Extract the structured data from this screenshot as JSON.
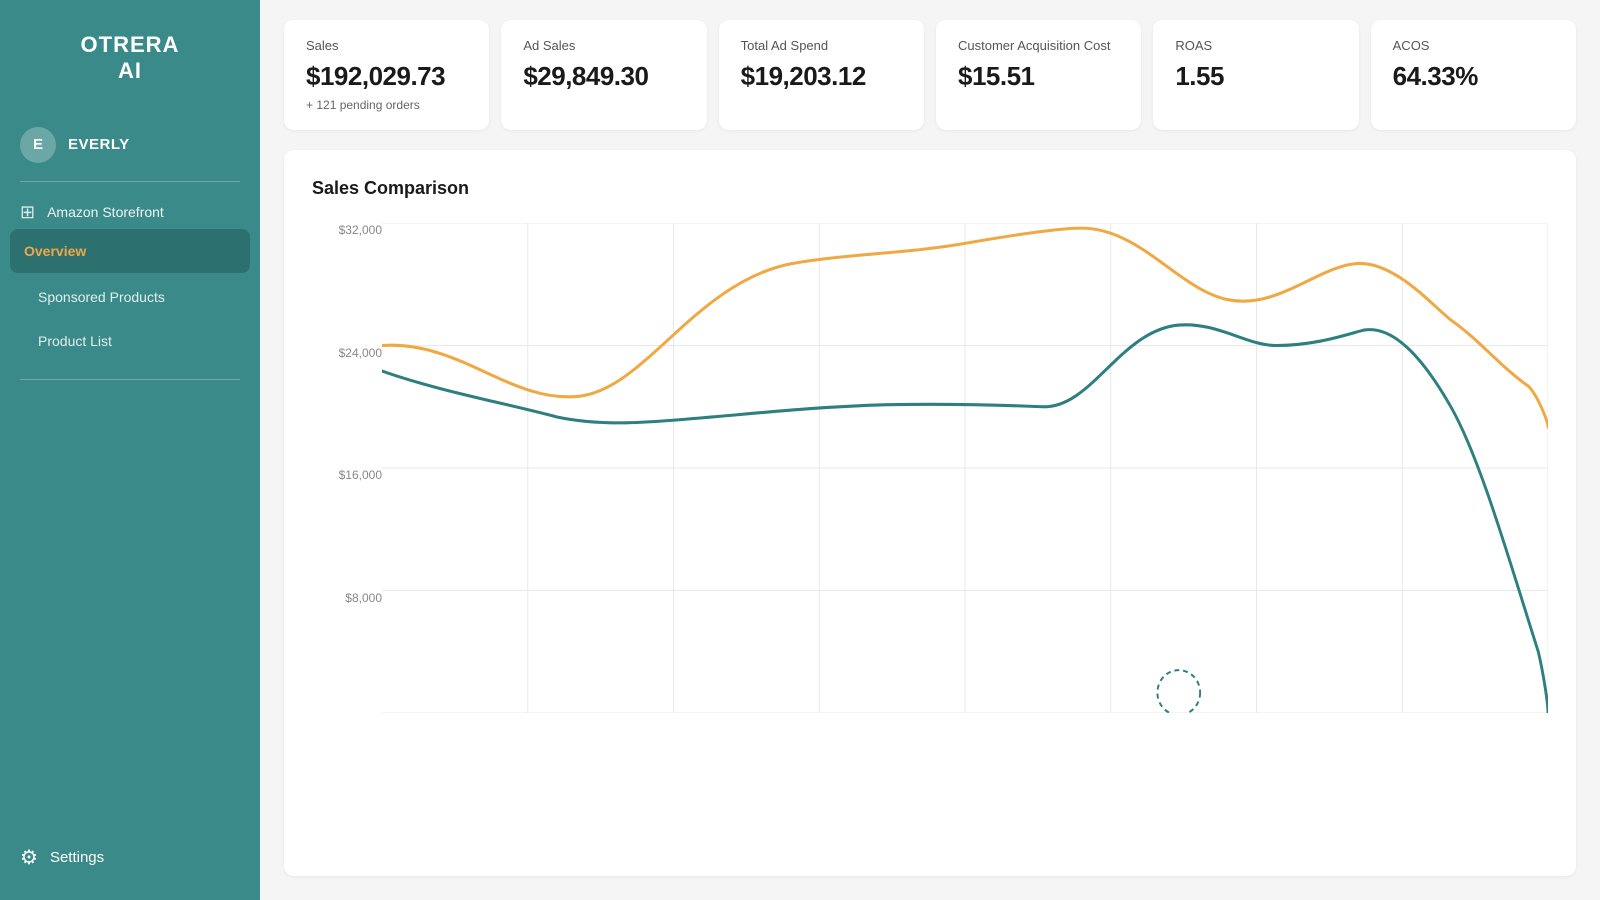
{
  "app": {
    "logo_line1": "OTRERA",
    "logo_line2": "AI"
  },
  "user": {
    "initial": "E",
    "name": "EVERLY"
  },
  "sidebar": {
    "amazon_storefront_label": "Amazon Storefront",
    "overview_label": "Overview",
    "sponsored_products_label": "Sponsored Products",
    "product_list_label": "Product List",
    "settings_label": "Settings"
  },
  "metrics": {
    "sales": {
      "label": "Sales",
      "value": "$192,029.73",
      "sub": "+ 121 pending orders"
    },
    "ad_sales": {
      "label": "Ad Sales",
      "value": "$29,849.30"
    },
    "total_ad_spend": {
      "label": "Total Ad Spend",
      "value": "$19,203.12"
    },
    "customer_acquisition_cost": {
      "label": "Customer Acquisition Cost",
      "value": "$15.51"
    },
    "roas": {
      "label": "ROAS",
      "value": "1.55"
    },
    "acos": {
      "label": "ACOS",
      "value": "64.33%"
    }
  },
  "chart": {
    "title": "Sales Comparison",
    "y_labels": [
      "$32,000",
      "$24,000",
      "$16,000",
      "$8,000",
      ""
    ],
    "colors": {
      "orange": "#f0a843",
      "teal": "#2e7f7f"
    }
  }
}
